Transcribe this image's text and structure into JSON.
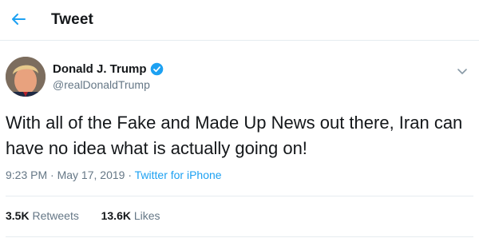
{
  "header": {
    "title": "Tweet",
    "back_icon": "back-arrow-icon"
  },
  "author": {
    "name": "Donald J. Trump",
    "handle": "@realDonaldTrump",
    "verified": true
  },
  "tweet": {
    "text": "With all of the Fake and Made Up News out there, Iran can have no idea what is actually going on!",
    "time": "9:23 PM",
    "date": "May 17, 2019",
    "source": "Twitter for iPhone"
  },
  "stats": {
    "retweets_count": "3.5K",
    "retweets_label": "Retweets",
    "likes_count": "13.6K",
    "likes_label": "Likes"
  },
  "colors": {
    "accent": "#1da1f2",
    "text_primary": "#14171a",
    "text_secondary": "#657786",
    "divider": "#e6ecf0"
  }
}
